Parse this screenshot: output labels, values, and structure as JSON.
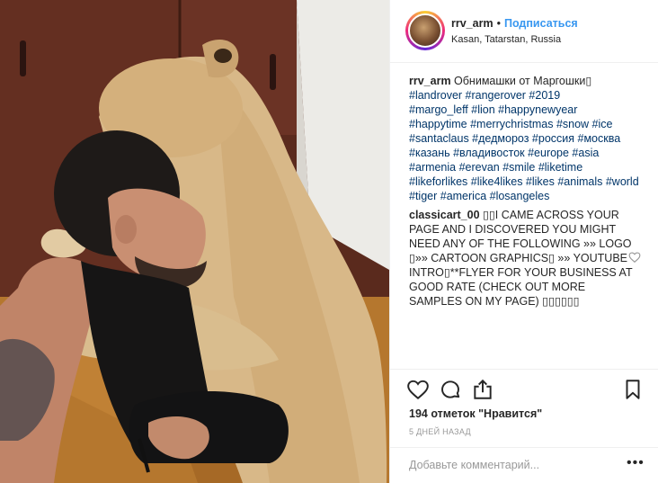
{
  "header": {
    "username": "rrv_arm",
    "separator": "•",
    "follow_label": "Подписаться",
    "location": "Kasan, Tatarstan, Russia"
  },
  "caption": {
    "author": "rrv_arm",
    "text": " Обнимашки от Маргошки▯",
    "lines": [
      "#landrover #rangerover #2019",
      "#margo_leff #lion #happynewyear",
      "#happytime #merrychristmas #snow #ice",
      "#santaclaus #дедмороз #россия #москва",
      "#казань #владивосток #europe #asia",
      "#armenia #erevan #smile #liketime",
      "#likeforlikes #like4likes #likes #animals #world",
      "#tiger #america #losangeles"
    ]
  },
  "comment": {
    "author": "classicart_00",
    "first_line": " ▯▯I CAME ACROSS YOUR",
    "lines": [
      "PAGE AND I DISCOVERED YOU MIGHT",
      "NEED ANY OF THE FOLLOWING »» LOGO",
      "▯»» CARTOON GRAPHICS▯ »» YOUTUBE",
      "INTRO▯**FLYER FOR YOUR BUSINESS AT",
      "GOOD RATE (CHECK OUT MORE",
      "SAMPLES ON MY PAGE) ▯▯▯▯▯▯"
    ]
  },
  "icons": {
    "like": "heart-icon",
    "comment": "comment-bubble-icon",
    "share": "share-icon",
    "save": "bookmark-icon",
    "comment_like": "heart-icon",
    "more": "more-dots-icon"
  },
  "likes": "194 отметок \"Нравится\"",
  "time": "5 дней назад",
  "add_comment": {
    "placeholder": "Добавьте комментарий...",
    "more_label": "•••"
  },
  "colors": {
    "link": "#3897f0",
    "hashtag": "#003569",
    "muted": "#999999",
    "border": "#efefef"
  }
}
